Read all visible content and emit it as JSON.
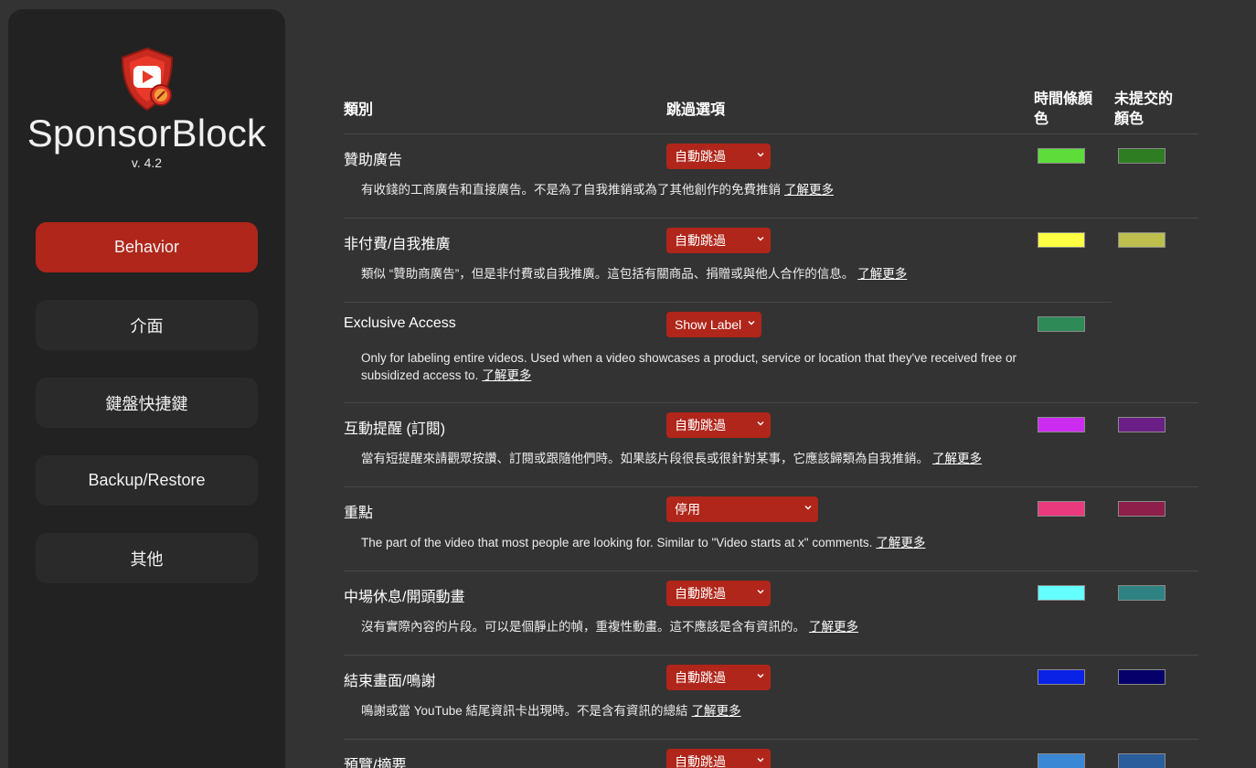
{
  "app": {
    "title": "SponsorBlock",
    "version": "v. 4.2"
  },
  "nav": [
    {
      "label": "Behavior",
      "active": true
    },
    {
      "label": "介面",
      "active": false
    },
    {
      "label": "鍵盤快捷鍵",
      "active": false
    },
    {
      "label": "Backup/Restore",
      "active": false
    },
    {
      "label": "其他",
      "active": false
    }
  ],
  "table": {
    "headers": {
      "category": "類別",
      "skip_option": "跳過選項",
      "timeline_color": "時間條顏色",
      "unsubmitted_color": "未提交的顏色"
    },
    "learn_more": "了解更多",
    "rows": [
      {
        "name": "贊助廣告",
        "option": "自動跳過",
        "desc": "有收錢的工商廣告和直接廣告。不是為了自我推銷或為了其他創作的免費推銷",
        "color": "#5ddc3a",
        "unsubmitted_color": "#2e7d23"
      },
      {
        "name": "非付費/自我推廣",
        "option": "自動跳過",
        "desc": "類似 “贊助商廣告”，但是非付費或自我推廣。這包括有關商品、捐贈或與他人合作的信息。",
        "color": "#ffff44",
        "unsubmitted_color": "#bcbf4e"
      },
      {
        "name": "Exclusive Access",
        "option": "Show Label",
        "desc": "Only for labeling entire videos. Used when a video showcases a product, service or location that they've received free or subsidized access to.",
        "color": "#2e8b57",
        "unsubmitted_color": null
      },
      {
        "name": "互動提醒 (訂閱)",
        "option": "自動跳過",
        "desc": "當有短提醒來請觀眾按讚、訂閱或跟隨他們時。如果該片段很長或很針對某事，它應該歸類為自我推銷。",
        "color": "#cc2cf0",
        "unsubmitted_color": "#6a1f87"
      },
      {
        "name": "重點",
        "option": "停用",
        "desc": "The part of the video that most people are looking for. Similar to \"Video starts at x\" comments.",
        "color": "#ea3a7e",
        "unsubmitted_color": "#8e1e4a"
      },
      {
        "name": "中場休息/開頭動畫",
        "option": "自動跳過",
        "desc": "沒有實際內容的片段。可以是個靜止的幀，重複性動畫。這不應該是含有資訊的。",
        "color": "#66ffff",
        "unsubmitted_color": "#2f8282"
      },
      {
        "name": "結束畫面/鳴謝",
        "option": "自動跳過",
        "desc": "鳴謝或當 YouTube 結尾資訊卡出現時。不是含有資訊的總結",
        "color": "#0a22e6",
        "unsubmitted_color": "#06006b"
      },
      {
        "name": "預覽/摘要",
        "option": "自動跳過",
        "desc": "",
        "color": "#3a87d6",
        "unsubmitted_color": "#2a5d9c"
      }
    ]
  }
}
